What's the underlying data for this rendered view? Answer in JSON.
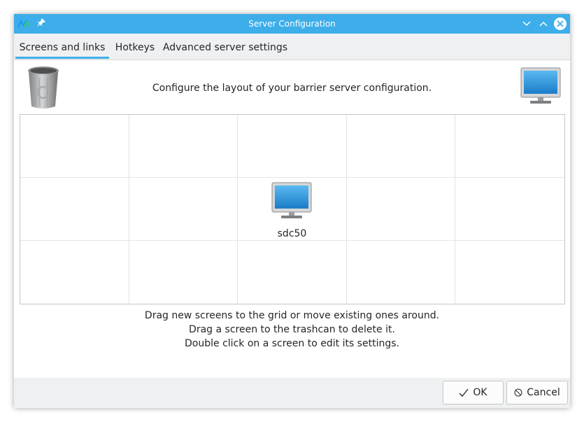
{
  "window": {
    "title": "Server Configuration",
    "accent_color": "#3daee9"
  },
  "tabs": [
    {
      "label": "Screens and links",
      "active": true
    },
    {
      "label": "Hotkeys",
      "active": false
    },
    {
      "label": "Advanced server settings",
      "active": false
    }
  ],
  "main": {
    "headline": "Configure the layout of your barrier server configuration.",
    "grid": {
      "columns": 5,
      "rows": 3,
      "screens": [
        {
          "name": "sdc50",
          "row": 1,
          "col": 2
        }
      ]
    },
    "help_lines": [
      "Drag new screens to the grid or move existing ones around.",
      "Drag a screen to the trashcan to delete it.",
      "Double click on a screen to edit its settings."
    ]
  },
  "buttons": {
    "ok_label": "OK",
    "cancel_label": "Cancel"
  },
  "icons": {
    "trash": "trashcan-icon",
    "new_screen": "monitor-icon",
    "ok": "checkmark-icon",
    "cancel": "cancel-icon"
  }
}
